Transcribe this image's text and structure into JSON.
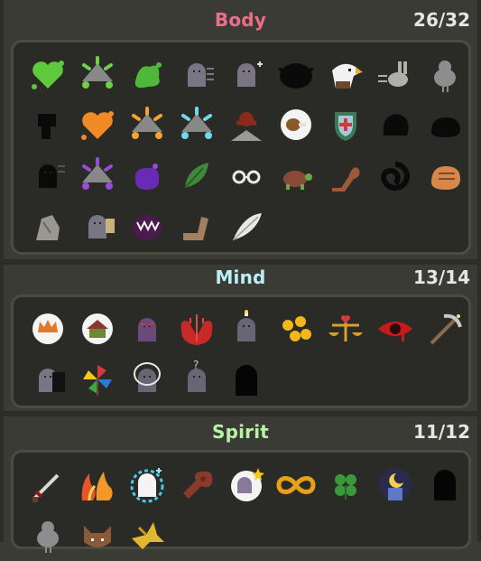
{
  "sections": [
    {
      "key": "body",
      "title": "Body",
      "title_color": "#ec6d8a",
      "count": "26/32",
      "icons": [
        "green-heart-splash-icon",
        "green-mountain-splash-icon",
        "green-slime-splash-icon",
        "gray-ghost-dash-icon",
        "gray-ghost-sparkle-icon",
        "black-mystery-creature-icon",
        "eagle-head-icon",
        "gray-rabbit-dash-icon",
        "gray-bird-icon",
        "black-silhouette-icon",
        "orange-heart-splash-icon",
        "orange-mountain-splash-icon",
        "cyan-mountain-splash-icon",
        "red-imp-on-rock-icon",
        "drumstick-bubble-icon",
        "health-shield-icon",
        "black-hand-icon",
        "black-fist-icon",
        "black-ghost-dash-icon",
        "purple-mountain-splash-icon",
        "purple-blob-icon",
        "green-leaf-icon",
        "glasses-icon",
        "turtle-icon",
        "flexed-arm-icon",
        "black-swirl-icon",
        "orange-fist-icon",
        "gray-rock-icon",
        "gray-ghost-card-icon",
        "purple-fanged-mouth-icon",
        "bent-arm-icon",
        "white-feather-icon"
      ]
    },
    {
      "key": "mind",
      "title": "Mind",
      "title_color": "#b8f0f5",
      "count": "13/14",
      "icons": [
        "crown-thought-bubble-icon",
        "house-thought-bubble-icon",
        "purple-evil-ghost-icon",
        "red-demon-trident-icon",
        "ghost-candle-icon",
        "gold-coins-icon",
        "balance-scale-heart-icon",
        "red-eye-icon",
        "pickaxe-icon",
        "gray-ghost-shadow-icon",
        "pinwheel-icon",
        "ghost-halo-icon",
        "ghost-question-icon",
        "black-ghost-silhouette-icon"
      ]
    },
    {
      "key": "spirit",
      "title": "Spirit",
      "title_color": "#b7f3a6",
      "count": "11/12",
      "icons": [
        "sword-icon",
        "fire-pair-icon",
        "ice-spirit-icon",
        "meat-bat-icon",
        "ghost-star-bubble-icon",
        "infinity-icon",
        "clover-icon",
        "moon-lantern-icon",
        "black-ghost-silhouette-icon",
        "gray-bird-icon",
        "fox-face-icon",
        "gold-bird-icon"
      ]
    }
  ]
}
